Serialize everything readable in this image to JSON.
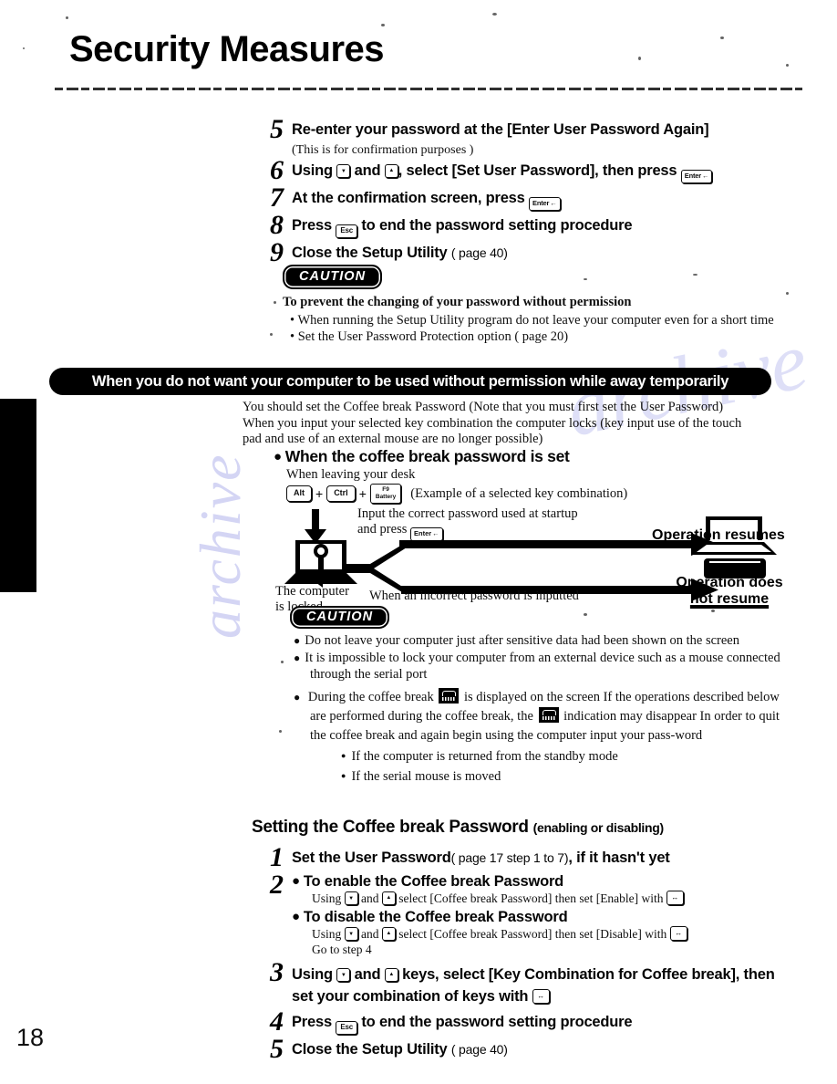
{
  "page": {
    "title": "Security Measures",
    "number": "18"
  },
  "watermark": {
    "text": "archive"
  },
  "steps_top": [
    {
      "num": "5",
      "text": "Re-enter your password at the [Enter User Password Again]",
      "note": "(This is for confirmation purposes )"
    },
    {
      "num": "6",
      "text_before": "Using",
      "key1": "down-arrow",
      "text_mid": "and",
      "key2": "up-arrow",
      "text_after": ", select [Set User Password], then press",
      "key3": "Enter"
    },
    {
      "num": "7",
      "text_before": "At the confirmation screen, press",
      "key1": "Enter"
    },
    {
      "num": "8",
      "text_before": "Press",
      "key1": "Esc",
      "text_after": "to end the password setting procedure"
    },
    {
      "num": "9",
      "text_before": "Close the Setup Utility",
      "pageref": "( page 40)"
    }
  ],
  "caution_1": {
    "badge": "CAUTION",
    "heading": "To prevent the changing of your password without permission",
    "bullets": [
      "When running the Setup Utility program  do not leave your computer even for a short time",
      "Set the User Password Protection option ( page 20)"
    ]
  },
  "banner": {
    "text": "When you do not want your computer to be used without permission while away temporarily"
  },
  "intro": {
    "line1": "You should set the  Coffee break Password   (Note that you must first set the User Password)",
    "line2": "When you input your selected key combination  the computer locks (key input  use of the touch",
    "line3": "pad and use of an external mouse are no longer possible)"
  },
  "diagram": {
    "heading": "When the coffee break password is set",
    "leaving_desk": "When leaving your desk",
    "key_alt": "Alt",
    "key_ctrl": "Ctrl",
    "key_fn_line1": "F9",
    "key_fn_line2": "Battery",
    "plus": "+",
    "example_note": "(Example of a selected key combination)",
    "input_line1": "Input the correct password used at startup",
    "input_line2": "and press",
    "key_enter": "Enter",
    "locked_line1": "The computer",
    "locked_line2": "is locked",
    "incorrect_note": "When an incorrect password is inputted",
    "resume": "Operation resumes",
    "no_resume_line1": "Operation does",
    "no_resume_line2": "not resume"
  },
  "caution_2": {
    "badge": "CAUTION",
    "items": [
      "Do not leave your computer just after sensitive data had been shown on the screen",
      "It is impossible to lock your computer from an external device  such as a mouse connected through the serial port"
    ],
    "coffee_item": {
      "part1": "During the coffee break",
      "part2": "is displayed on the screen  If the operations described below are performed during the coffee break, the",
      "part3": "indication may disappear  In order to quit the coffee break and again begin using the computer  input your pass-word",
      "subitems": [
        "If the computer is returned from the standby mode",
        "If the serial mouse is moved"
      ]
    }
  },
  "section": {
    "heading": "Setting the Coffee break Password",
    "heading_paren": "(enabling or disabling)"
  },
  "steps_bottom": [
    {
      "num": "1",
      "text_before": "Set the User Password",
      "pageref": "( page 17 step 1 to 7)",
      "text_after": ", if it hasn't yet"
    },
    {
      "num": "2",
      "enable_heading": "To enable the Coffee break Password",
      "enable_proc_before": "Using",
      "enable_proc_mid": "and",
      "enable_proc_after": "select [Coffee break Password]  then set [Enable] with",
      "disable_heading": "To disable the Coffee break Password",
      "disable_proc_after": "select [Coffee break Password]  then set [Disable] with",
      "goto": "Go to step 4"
    },
    {
      "num": "3",
      "line1_before": "Using",
      "line1_mid": "and",
      "line1_after": "keys, select [Key Combination for Coffee",
      "line2": "break], then set your combination of keys with"
    },
    {
      "num": "4",
      "text_before": "Press",
      "key1": "Esc",
      "text_after": "to end the password setting procedure"
    },
    {
      "num": "5",
      "text_before": "Close the Setup Utility",
      "pageref": "( page 40)"
    }
  ]
}
